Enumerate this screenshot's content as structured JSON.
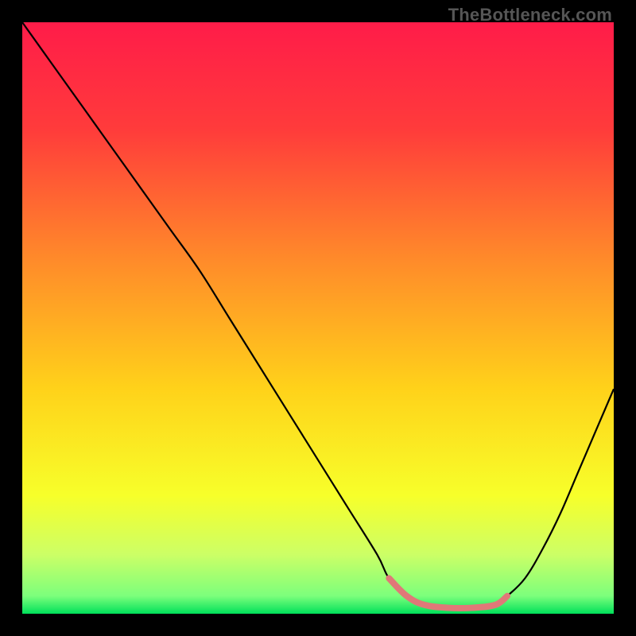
{
  "watermark": "TheBottleneck.com",
  "chart_data": {
    "type": "line",
    "title": "",
    "xlabel": "",
    "ylabel": "",
    "xlim": [
      0,
      100
    ],
    "ylim": [
      0,
      100
    ],
    "gradient_stops": [
      {
        "offset": 0,
        "color": "#ff1c49"
      },
      {
        "offset": 18,
        "color": "#ff3b3b"
      },
      {
        "offset": 40,
        "color": "#ff8a2a"
      },
      {
        "offset": 62,
        "color": "#ffd21a"
      },
      {
        "offset": 80,
        "color": "#f7ff2a"
      },
      {
        "offset": 90,
        "color": "#ccff66"
      },
      {
        "offset": 97,
        "color": "#7cff7c"
      },
      {
        "offset": 100,
        "color": "#00e05a"
      }
    ],
    "series": [
      {
        "name": "bottleneck-curve",
        "stroke": "#000000",
        "x": [
          0,
          5,
          10,
          15,
          20,
          25,
          30,
          35,
          40,
          45,
          50,
          55,
          60,
          62,
          65,
          68,
          72,
          76,
          80,
          82,
          85,
          88,
          91,
          94,
          97,
          100
        ],
        "values": [
          100,
          93,
          86,
          79,
          72,
          65,
          58,
          50,
          42,
          34,
          26,
          18,
          10,
          6,
          3,
          1.5,
          1,
          1,
          1.5,
          3,
          6,
          11,
          17,
          24,
          31,
          38
        ]
      },
      {
        "name": "highlight-segment",
        "stroke": "#e07878",
        "x": [
          62,
          65,
          68,
          72,
          76,
          80,
          82
        ],
        "values": [
          6,
          3,
          1.5,
          1,
          1,
          1.5,
          3
        ]
      }
    ]
  }
}
